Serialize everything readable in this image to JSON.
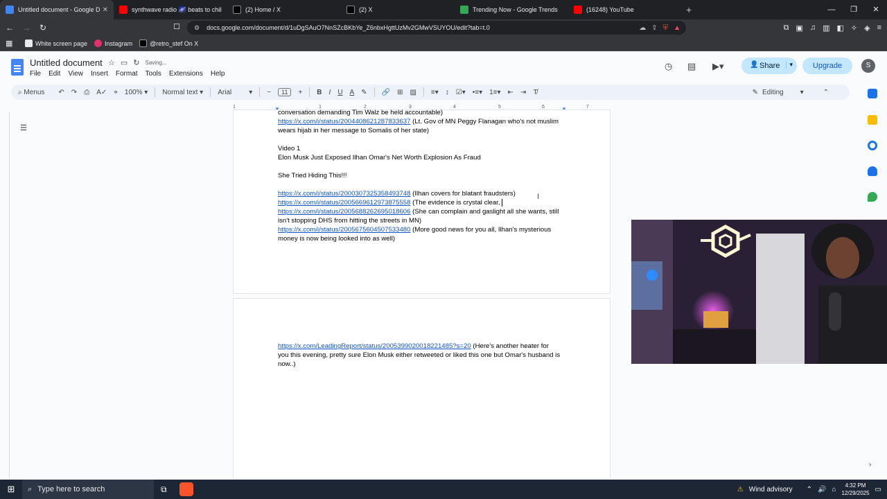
{
  "browser": {
    "tabs": [
      {
        "title": "Untitled document - Google Do",
        "color": "#4285f4",
        "active": true
      },
      {
        "title": "synthwave radio 🌌 beats to chill",
        "color": "#ff0000",
        "active": false
      },
      {
        "title": "(2) Home / X",
        "color": "#000000",
        "active": false
      },
      {
        "title": "(2) X",
        "color": "#000000",
        "active": false
      },
      {
        "title": "Trending Now - Google Trends",
        "color": "#34a853",
        "active": false
      },
      {
        "title": "(16248) YouTube",
        "color": "#ff0000",
        "active": false
      }
    ],
    "url": "docs.google.com/document/d/1uDgSAuO7NnSZcBKbYe_Z6nbxHgttUzMv2GMwVSUYOU/edit?tab=t.0",
    "bookmarks": [
      {
        "label": "White screen page",
        "color": "#e8eaed"
      },
      {
        "label": "Instagram",
        "color": "#e1306c"
      },
      {
        "label": "@retro_stef On X",
        "color": "#000000"
      }
    ]
  },
  "docs": {
    "title": "Untitled document",
    "saving": "Saving...",
    "menu": [
      "File",
      "Edit",
      "View",
      "Insert",
      "Format",
      "Tools",
      "Extensions",
      "Help"
    ],
    "share_label": "Share",
    "upgrade_label": "Upgrade",
    "avatar_letter": "S",
    "toolbar": {
      "menus": "Menus",
      "zoom": "100%",
      "style": "Normal text",
      "font": "Arial",
      "font_size": "11",
      "mode": "Editing"
    }
  },
  "document": {
    "page1_lines": [
      {
        "text": "conversation demanding Tim Walz be held accountable)",
        "link": ""
      },
      {
        "link": "https://x.com/i/status/2004408621287833637",
        "text": " (Lt. Gov of MN Peggy Flanagan who's not muslim"
      },
      {
        "text": "wears hijab in her message to Somalis of her state)",
        "link": ""
      },
      {
        "text": "Video 1",
        "link": ""
      },
      {
        "text": "Elon Musk Just Exposed Ilhan Omar's Net Worth Explosion As Fraud",
        "link": ""
      },
      {
        "text": "She Tried Hiding This!!!",
        "link": ""
      },
      {
        "link": "https://x.com/i/status/2000307325358493748",
        "text": " (Ilhan covers for blatant fraudsters)"
      },
      {
        "link": "https://x.com/i/status/2005669612973875558",
        "text": " (The evidence is crystal clear,"
      },
      {
        "link": "https://x.com/i/status/2005688262695018606",
        "text": " (She can complain and gaslight all she wants, still"
      },
      {
        "text": "isn't stopping DHS from hitting the streets in MN)",
        "link": ""
      },
      {
        "link": "https://x.com/i/status/2005675604507533480",
        "text": " (More good news for you all, Ilhan's mysterious"
      },
      {
        "text": "money is now being looked into as well)",
        "link": ""
      }
    ],
    "page2_lines": [
      {
        "link": "https://x.com/LeadingReport/status/2005399020018221485?s=20",
        "text": " (Here's another heater for"
      },
      {
        "text": "you this evening, pretty sure Elon Musk either retweeted or liked this one but Omar's husband is",
        "link": ""
      },
      {
        "text": "now..)",
        "link": ""
      }
    ]
  },
  "ruler_ticks": [
    "1",
    "1",
    "2",
    "3",
    "4",
    "5",
    "6",
    "7"
  ],
  "taskbar": {
    "search_placeholder": "Type here to search",
    "weather": "Wind advisory",
    "time": "4:32 PM",
    "date": "12/29/2025"
  }
}
